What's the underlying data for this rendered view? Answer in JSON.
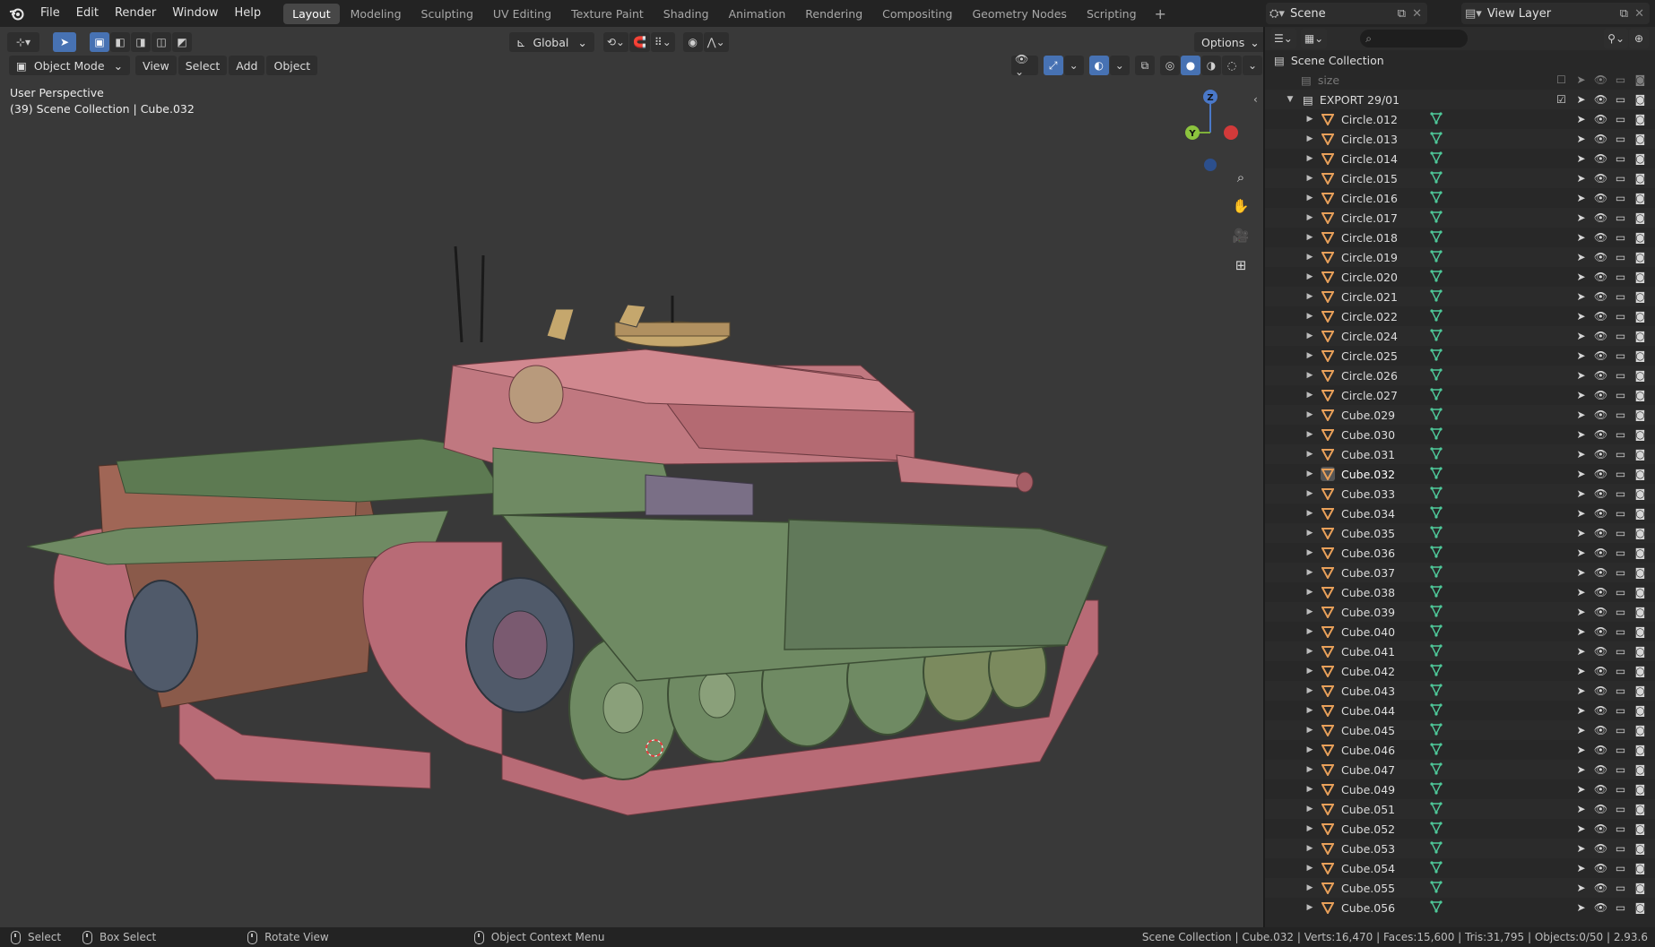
{
  "menus": [
    "File",
    "Edit",
    "Render",
    "Window",
    "Help"
  ],
  "workspaces": [
    {
      "label": "Layout",
      "active": true
    },
    {
      "label": "Modeling",
      "active": false
    },
    {
      "label": "Sculpting",
      "active": false
    },
    {
      "label": "UV Editing",
      "active": false
    },
    {
      "label": "Texture Paint",
      "active": false
    },
    {
      "label": "Shading",
      "active": false
    },
    {
      "label": "Animation",
      "active": false
    },
    {
      "label": "Rendering",
      "active": false
    },
    {
      "label": "Compositing",
      "active": false
    },
    {
      "label": "Geometry Nodes",
      "active": false
    },
    {
      "label": "Scripting",
      "active": false
    }
  ],
  "add_workspace": "+",
  "scene": {
    "name": "Scene",
    "view_layer": "View Layer"
  },
  "viewport": {
    "transform_orientation": "Global",
    "options_label": "Options",
    "mode": "Object Mode",
    "header_menus": [
      "View",
      "Select",
      "Add",
      "Object"
    ],
    "perspective_label": "User Perspective",
    "context_label": "(39) Scene Collection | Cube.032",
    "gizmo_axes": {
      "z": "Z",
      "y": "Y"
    }
  },
  "outliner": {
    "search_placeholder": "",
    "root": "Scene Collection",
    "rows": [
      {
        "name": "size",
        "kind": "collection-dim"
      },
      {
        "name": "EXPORT 29/01",
        "kind": "collection"
      },
      {
        "name": "Circle.012",
        "kind": "mesh"
      },
      {
        "name": "Circle.013",
        "kind": "mesh"
      },
      {
        "name": "Circle.014",
        "kind": "mesh"
      },
      {
        "name": "Circle.015",
        "kind": "mesh"
      },
      {
        "name": "Circle.016",
        "kind": "mesh"
      },
      {
        "name": "Circle.017",
        "kind": "mesh"
      },
      {
        "name": "Circle.018",
        "kind": "mesh"
      },
      {
        "name": "Circle.019",
        "kind": "mesh"
      },
      {
        "name": "Circle.020",
        "kind": "mesh"
      },
      {
        "name": "Circle.021",
        "kind": "mesh"
      },
      {
        "name": "Circle.022",
        "kind": "mesh"
      },
      {
        "name": "Circle.024",
        "kind": "mesh"
      },
      {
        "name": "Circle.025",
        "kind": "mesh"
      },
      {
        "name": "Circle.026",
        "kind": "mesh"
      },
      {
        "name": "Circle.027",
        "kind": "mesh"
      },
      {
        "name": "Cube.029",
        "kind": "mesh"
      },
      {
        "name": "Cube.030",
        "kind": "mesh"
      },
      {
        "name": "Cube.031",
        "kind": "mesh"
      },
      {
        "name": "Cube.032",
        "kind": "mesh",
        "selected": true
      },
      {
        "name": "Cube.033",
        "kind": "mesh"
      },
      {
        "name": "Cube.034",
        "kind": "mesh"
      },
      {
        "name": "Cube.035",
        "kind": "mesh"
      },
      {
        "name": "Cube.036",
        "kind": "mesh"
      },
      {
        "name": "Cube.037",
        "kind": "mesh"
      },
      {
        "name": "Cube.038",
        "kind": "mesh"
      },
      {
        "name": "Cube.039",
        "kind": "mesh"
      },
      {
        "name": "Cube.040",
        "kind": "mesh"
      },
      {
        "name": "Cube.041",
        "kind": "mesh"
      },
      {
        "name": "Cube.042",
        "kind": "mesh"
      },
      {
        "name": "Cube.043",
        "kind": "mesh"
      },
      {
        "name": "Cube.044",
        "kind": "mesh"
      },
      {
        "name": "Cube.045",
        "kind": "mesh"
      },
      {
        "name": "Cube.046",
        "kind": "mesh"
      },
      {
        "name": "Cube.047",
        "kind": "mesh"
      },
      {
        "name": "Cube.049",
        "kind": "mesh"
      },
      {
        "name": "Cube.051",
        "kind": "mesh"
      },
      {
        "name": "Cube.052",
        "kind": "mesh"
      },
      {
        "name": "Cube.053",
        "kind": "mesh"
      },
      {
        "name": "Cube.054",
        "kind": "mesh"
      },
      {
        "name": "Cube.055",
        "kind": "mesh"
      },
      {
        "name": "Cube.056",
        "kind": "mesh"
      }
    ]
  },
  "status": {
    "select": "Select",
    "box_select": "Box Select",
    "rotate_view": "Rotate View",
    "context_menu": "Object Context Menu",
    "stats": "Scene Collection | Cube.032 | Verts:16,470 | Faces:15,600 | Tris:31,795 | Objects:0/50 | 2.93.6"
  },
  "colors": {
    "accent": "#4772b3",
    "mesh_icon": "#e8a05a",
    "data_icon": "#4fc99a",
    "tank_body": "#b86b76",
    "tank_green": "#6f8a63",
    "tank_brown": "#8a5a4a"
  }
}
